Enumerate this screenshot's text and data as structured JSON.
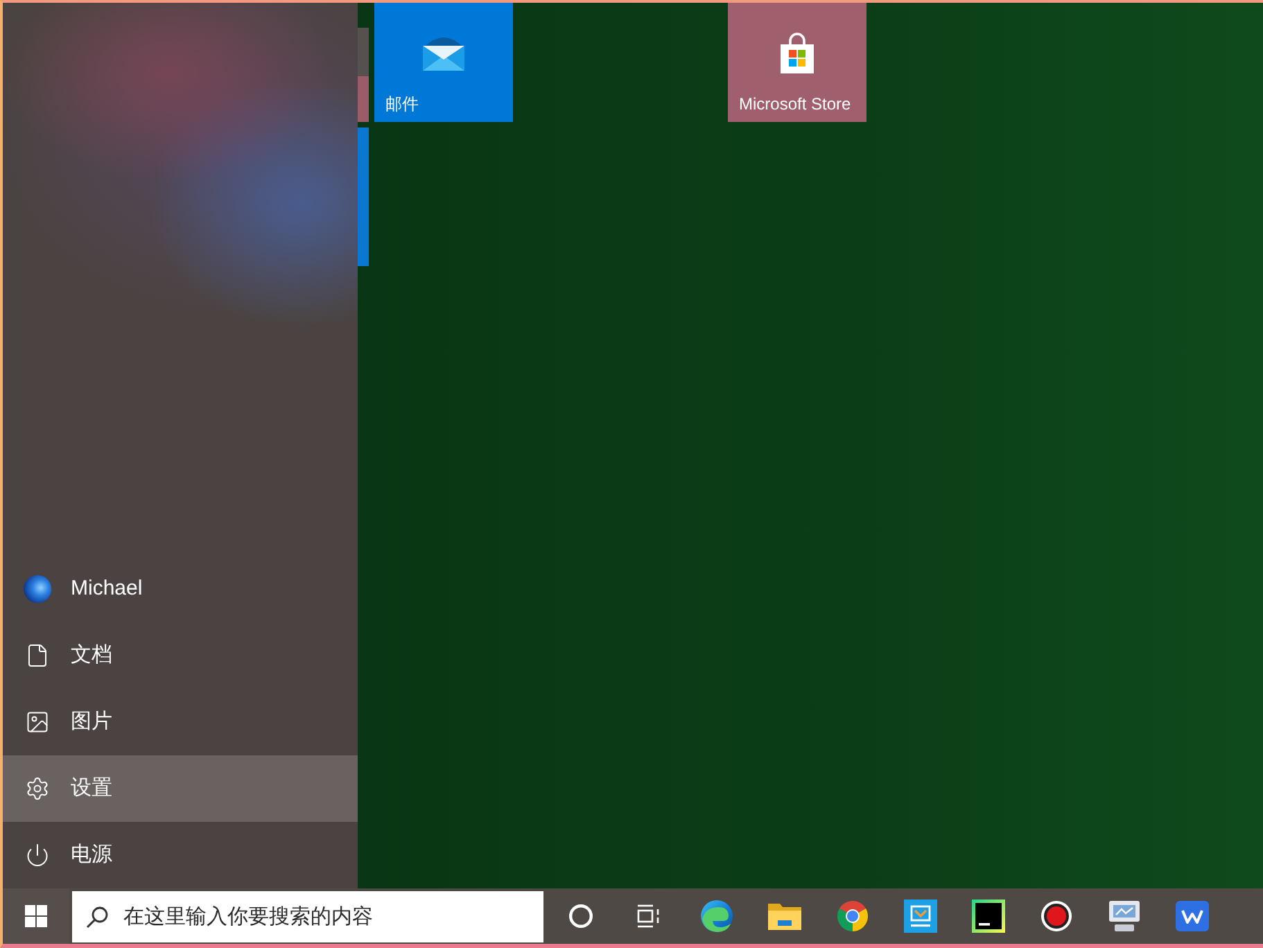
{
  "start_menu": {
    "user": {
      "name": "Michael"
    },
    "items": [
      {
        "kind": "document",
        "label": "文档",
        "selected": false
      },
      {
        "kind": "picture",
        "label": "图片",
        "selected": false
      },
      {
        "kind": "settings",
        "label": "设置",
        "selected": true
      },
      {
        "kind": "power",
        "label": "电源",
        "selected": false
      }
    ]
  },
  "tiles": [
    {
      "kind": "mail",
      "label": "邮件",
      "color": "#0078d7"
    },
    {
      "kind": "store",
      "label": "Microsoft Store",
      "color": "#a05f6c"
    }
  ],
  "taskbar": {
    "search": {
      "placeholder": "在这里输入你要搜索的内容"
    }
  }
}
